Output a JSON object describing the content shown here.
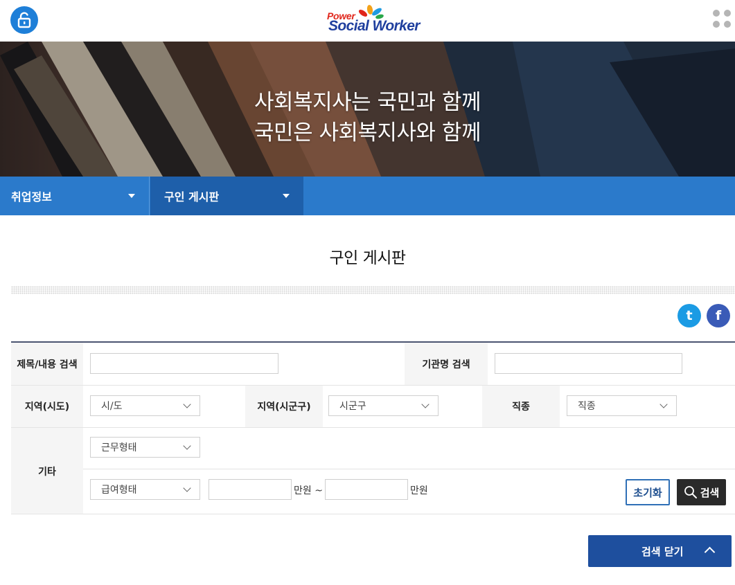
{
  "header": {
    "logo_top": "Power",
    "logo_main": "Social Worker",
    "lock_icon": "unlock-icon",
    "apps_icon": "apps-grid-icon"
  },
  "hero": {
    "line1": "사회복지사는 국민과 함께",
    "line2": "국민은 사회복지사와 함께"
  },
  "subnav": {
    "item1": "취업정보",
    "item2": "구인 게시판"
  },
  "page_title": "구인 게시판",
  "social": {
    "twitter": "t",
    "facebook": "f"
  },
  "search": {
    "title_content_label": "제목/내용 검색",
    "title_content_value": "",
    "org_label": "기관명 검색",
    "org_value": "",
    "region_sido_label": "지역(시도)",
    "region_sido_value": "시/도",
    "region_sigungu_label": "지역(시군구)",
    "region_sigungu_value": "시군구",
    "job_label": "직종",
    "job_value": "직종",
    "etc_label": "기타",
    "work_type_value": "근무형태",
    "pay_type_value": "급여형태",
    "pay_min_value": "",
    "pay_max_value": "",
    "unit_from": "만원 ~",
    "unit_to": "만원",
    "reset_label": "초기화",
    "search_label": "검색"
  },
  "close_search_label": "검색 닫기",
  "colors": {
    "brand_blue": "#2b7acb",
    "nav_active": "#1e5faa",
    "close_btn": "#1e4f9e",
    "search_btn": "#2a2a2a"
  }
}
